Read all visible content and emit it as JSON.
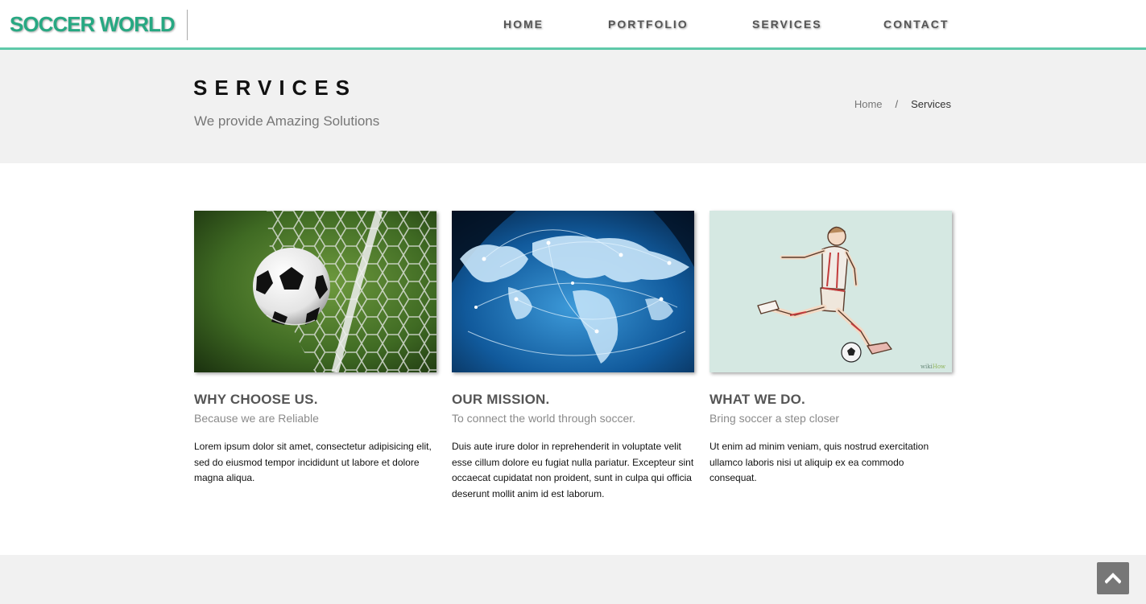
{
  "header": {
    "logo": "SOCCER WORLD",
    "nav": [
      {
        "label": "HOME"
      },
      {
        "label": "PORTFOLIO"
      },
      {
        "label": "SERVICES"
      },
      {
        "label": "CONTACT"
      }
    ]
  },
  "banner": {
    "title": "SERVICES",
    "subtitle": "We provide Amazing Solutions",
    "breadcrumb": {
      "home": "Home",
      "separator": "/",
      "current": "Services"
    }
  },
  "services": [
    {
      "image": "soccer-ball-in-net",
      "title": "WHY CHOOSE US.",
      "subtitle": "Because we are Reliable",
      "text": "Lorem ipsum dolor sit amet, consectetur adipisicing elit, sed do eiusmod tempor incididunt ut labore et dolore magna aliqua."
    },
    {
      "image": "world-network-globe",
      "title": "OUR MISSION.",
      "subtitle": "To connect the world through soccer.",
      "text": "Duis aute irure dolor in reprehenderit in voluptate velit esse cillum dolore eu fugiat nulla pariatur. Excepteur sint occaecat cupidatat non proident, sunt in culpa qui officia deserunt mollit anim id est laborum."
    },
    {
      "image": "soccer-player-kicking-illustration",
      "image_watermark": "wikiHow",
      "title": "WHAT WE DO.",
      "subtitle": "Bring soccer a step closer",
      "text": "Ut enim ad minim veniam, quis nostrud exercitation ullamco laboris nisi ut aliquip ex ea commodo consequat."
    }
  ],
  "scroll_top": {
    "icon": "chevron-up-icon"
  },
  "colors": {
    "accent": "#27a882",
    "header_border": "#5ec9a9",
    "banner_bg": "#f1f1f1",
    "nav_text": "#555555"
  }
}
